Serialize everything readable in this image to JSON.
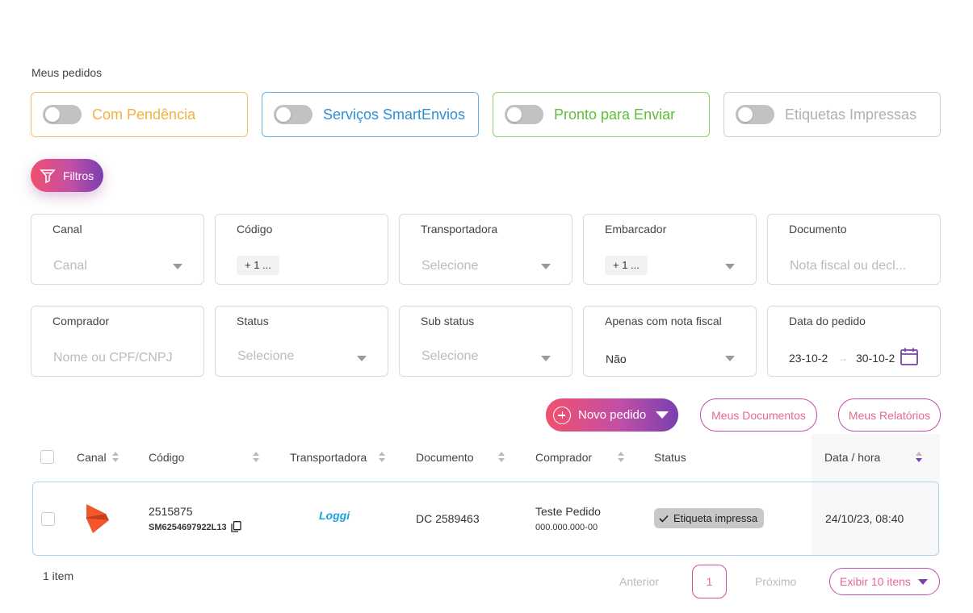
{
  "page": {
    "title": "Meus pedidos"
  },
  "toggles": [
    {
      "label": "Com Pendência",
      "color": "#f5b042",
      "border": "#f3c067",
      "on": false
    },
    {
      "label": "Serviços SmartEnvios",
      "color": "#2e8fd6",
      "border": "#62b0e8",
      "on": false
    },
    {
      "label": "Pronto para Enviar",
      "color": "#5fbf3b",
      "border": "#8ed36f",
      "on": false
    },
    {
      "label": "Etiquetas Impressas",
      "color": "#b0b0b0",
      "border": "#d0d0d0",
      "on": false
    }
  ],
  "filters_button": {
    "label": "Filtros"
  },
  "filters": {
    "canal": {
      "label": "Canal",
      "placeholder": "Canal"
    },
    "codigo": {
      "label": "Código",
      "chip": "+ 1 ..."
    },
    "transportadora": {
      "label": "Transportadora",
      "placeholder": "Selecione"
    },
    "embarcador": {
      "label": "Embarcador",
      "chip": "+ 1 ..."
    },
    "documento": {
      "label": "Documento",
      "placeholder": "Nota fiscal ou decl..."
    },
    "comprador": {
      "label": "Comprador",
      "placeholder": "Nome ou CPF/CNPJ"
    },
    "status": {
      "label": "Status",
      "placeholder": "Selecione"
    },
    "sub_status": {
      "label": "Sub status",
      "placeholder": "Selecione"
    },
    "nota_fiscal": {
      "label": "Apenas com nota fiscal",
      "value": "Não"
    },
    "data_pedido": {
      "label": "Data do pedido",
      "from": "23-10-2",
      "to": "30-10-2",
      "arrow": "→"
    }
  },
  "actions": {
    "novo_pedido": "Novo pedido",
    "meus_documentos": "Meus Documentos",
    "meus_relatorios": "Meus Relatórios"
  },
  "table": {
    "columns": [
      "Canal",
      "Código",
      "Transportadora",
      "Documento",
      "Comprador",
      "Status",
      "Data / hora"
    ],
    "rows": [
      {
        "canal_icon": "smartenvios-logo-icon",
        "codigo": "2515875",
        "codigo_tracking": "SM6254697922L13",
        "transportadora": "Loggi",
        "documento": "DC 2589463",
        "comprador": "Teste Pedido",
        "comprador_doc": "000.000.000-00",
        "status": "Etiqueta impressa",
        "data_hora": "24/10/23, 08:40"
      }
    ]
  },
  "pagination": {
    "items_count": "1 item",
    "prev": "Anterior",
    "page": "1",
    "next": "Próximo",
    "page_size": "Exibir 10 itens"
  },
  "colors": {
    "accent_gradient_start": "#f0506e",
    "accent_gradient_end": "#7a3fb0",
    "loggi": "#1fa0e0",
    "channel_logo": "#f2562a"
  }
}
